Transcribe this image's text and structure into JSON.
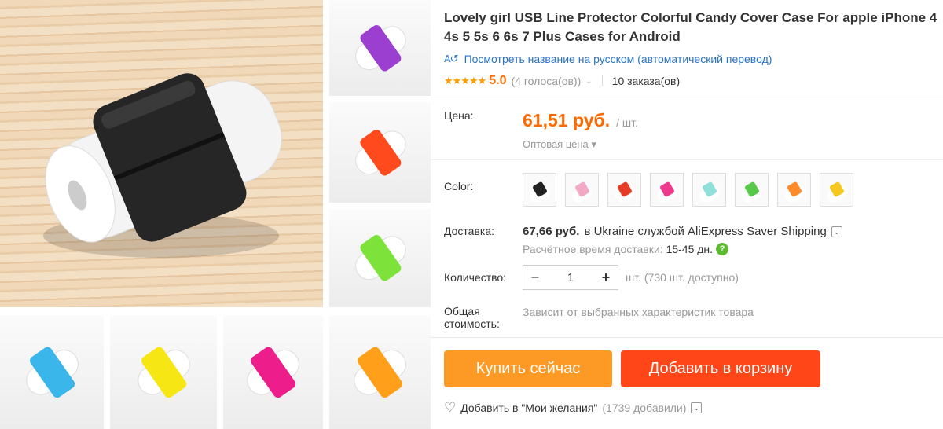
{
  "product": {
    "title": "Lovely girl USB Line Protector Colorful Candy Cover Case For apple iPhone 4 4s 5 5s 6 6s 7 Plus Cases for Android",
    "translate_link": "Посмотреть название на русском (автоматический перевод)",
    "stars": "★★★★★",
    "rating": "5.0",
    "votes": "(4 голоса(ов))",
    "orders": "10 заказа(ов)"
  },
  "price": {
    "label": "Цена:",
    "value": "61,51 руб.",
    "unit": "/ шт.",
    "wholesale": "Оптовая цена ▾"
  },
  "color": {
    "label": "Color:",
    "options": [
      "#222222",
      "#f2a9c4",
      "#e63b26",
      "#ee3a8c",
      "#8ee0d8",
      "#57c84a",
      "#ff8a2a",
      "#f6c81f"
    ]
  },
  "shipping": {
    "label": "Доставка:",
    "price": "67,66 руб.",
    "text": "в Ukraine службой AliExpress Saver Shipping",
    "time_label": "Расчётное время доставки:",
    "time_value": "15-45 дн."
  },
  "quantity": {
    "label": "Количество:",
    "value": "1",
    "available": "шт. (730 шт. доступно)"
  },
  "total": {
    "label": "Общая стоимость:",
    "text": "Зависит от выбранных характеристик товара"
  },
  "buttons": {
    "buy": "Купить сейчас",
    "cart": "Добавить в корзину"
  },
  "wishlist": {
    "text": "Добавить в \"Мои желания\"",
    "count": "(1739 добавили)"
  },
  "gallery": {
    "thumbs_right": [
      "#9b3fd1",
      "#ff4a1e",
      "#7de23a"
    ],
    "thumbs_bottom": [
      "#3ab6ea",
      "#f6e614",
      "#ee1d8c",
      "#ff9f1a"
    ]
  },
  "colors": {
    "accent": "#ff6a00",
    "link": "#2773c8",
    "buy_btn": "#fd9a26",
    "cart_btn": "#ff4619"
  }
}
